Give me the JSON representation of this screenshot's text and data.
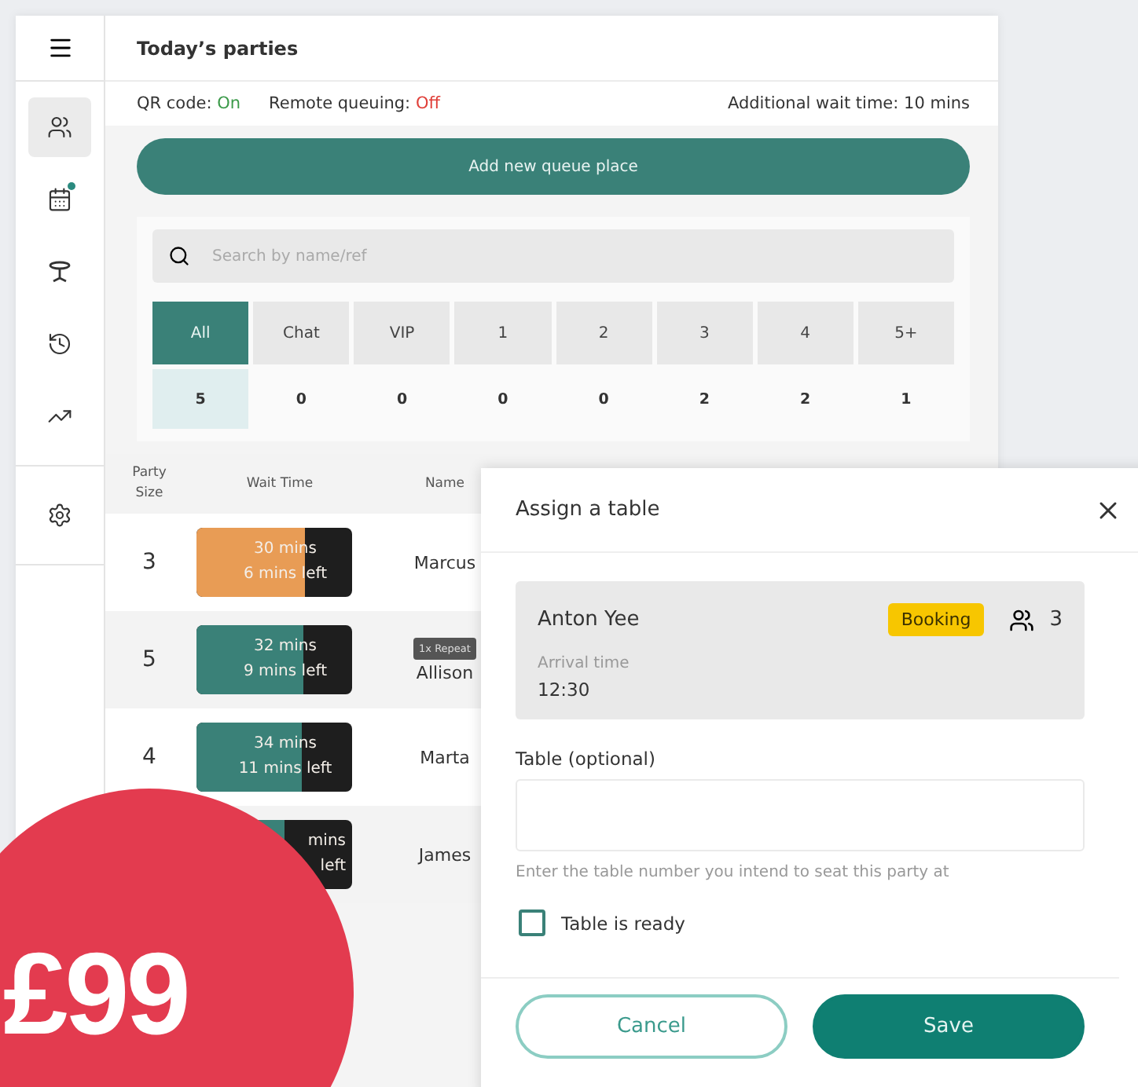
{
  "header": {
    "title": "Today’s parties"
  },
  "sidebar": {
    "items": [
      {
        "kind": "people",
        "selected": true,
        "badge": false
      },
      {
        "kind": "calendar",
        "selected": false,
        "badge": true
      },
      {
        "kind": "table",
        "selected": false,
        "badge": false
      },
      {
        "kind": "history",
        "selected": false,
        "badge": false
      },
      {
        "kind": "chart",
        "selected": false,
        "badge": false
      },
      {
        "kind": "settings",
        "selected": false,
        "badge": false
      }
    ]
  },
  "status_bar": {
    "qr_label": "QR code:",
    "qr_value": "On",
    "qr_on": true,
    "remote_label": "Remote queuing:",
    "remote_value": "Off",
    "remote_on": false,
    "wait_label": "Additional wait time:",
    "wait_value": "10 mins"
  },
  "add_button": "Add new queue place",
  "search": {
    "placeholder": "Search by name/ref"
  },
  "filters": [
    {
      "label": "All",
      "count": "5",
      "selected": true
    },
    {
      "label": "Chat",
      "count": "0",
      "selected": false
    },
    {
      "label": "VIP",
      "count": "0",
      "selected": false
    },
    {
      "label": "1",
      "count": "0",
      "selected": false
    },
    {
      "label": "2",
      "count": "0",
      "selected": false
    },
    {
      "label": "3",
      "count": "2",
      "selected": false
    },
    {
      "label": "4",
      "count": "2",
      "selected": false
    },
    {
      "label": "5+",
      "count": "1",
      "selected": false
    }
  ],
  "table": {
    "columns": [
      "Party Size",
      "Wait Time",
      "Name"
    ],
    "rows": [
      {
        "party_size": "3",
        "wait": "30 mins",
        "left": "6 mins left",
        "level": 0.7,
        "color": "#e89c55",
        "name": "Marcus"
      },
      {
        "party_size": "5",
        "wait": "32 mins",
        "left": "9 mins left",
        "level": 0.69,
        "color": "#3a8178",
        "tag": "1x Repeat",
        "name": "Allison"
      },
      {
        "party_size": "4",
        "wait": "34 mins",
        "left": "11 mins left",
        "level": 0.68,
        "color": "#3a8178",
        "name": "Marta"
      },
      {
        "wait": "mins",
        "left": "left",
        "level": 0.57,
        "color": "#3a8178",
        "name": "James"
      }
    ]
  },
  "modal": {
    "title": "Assign a table",
    "guest": "Anton Yee",
    "tag": "Booking",
    "party": "3",
    "arrival_label": "Arrival time",
    "arrival": "12:30",
    "table_label": "Table (optional)",
    "table_hint": "Enter the table number you intend to seat this party at",
    "ready_label": "Table is ready",
    "ready_checked": false,
    "cancel": "Cancel",
    "save": "Save"
  },
  "promo": {
    "price": "£99"
  }
}
